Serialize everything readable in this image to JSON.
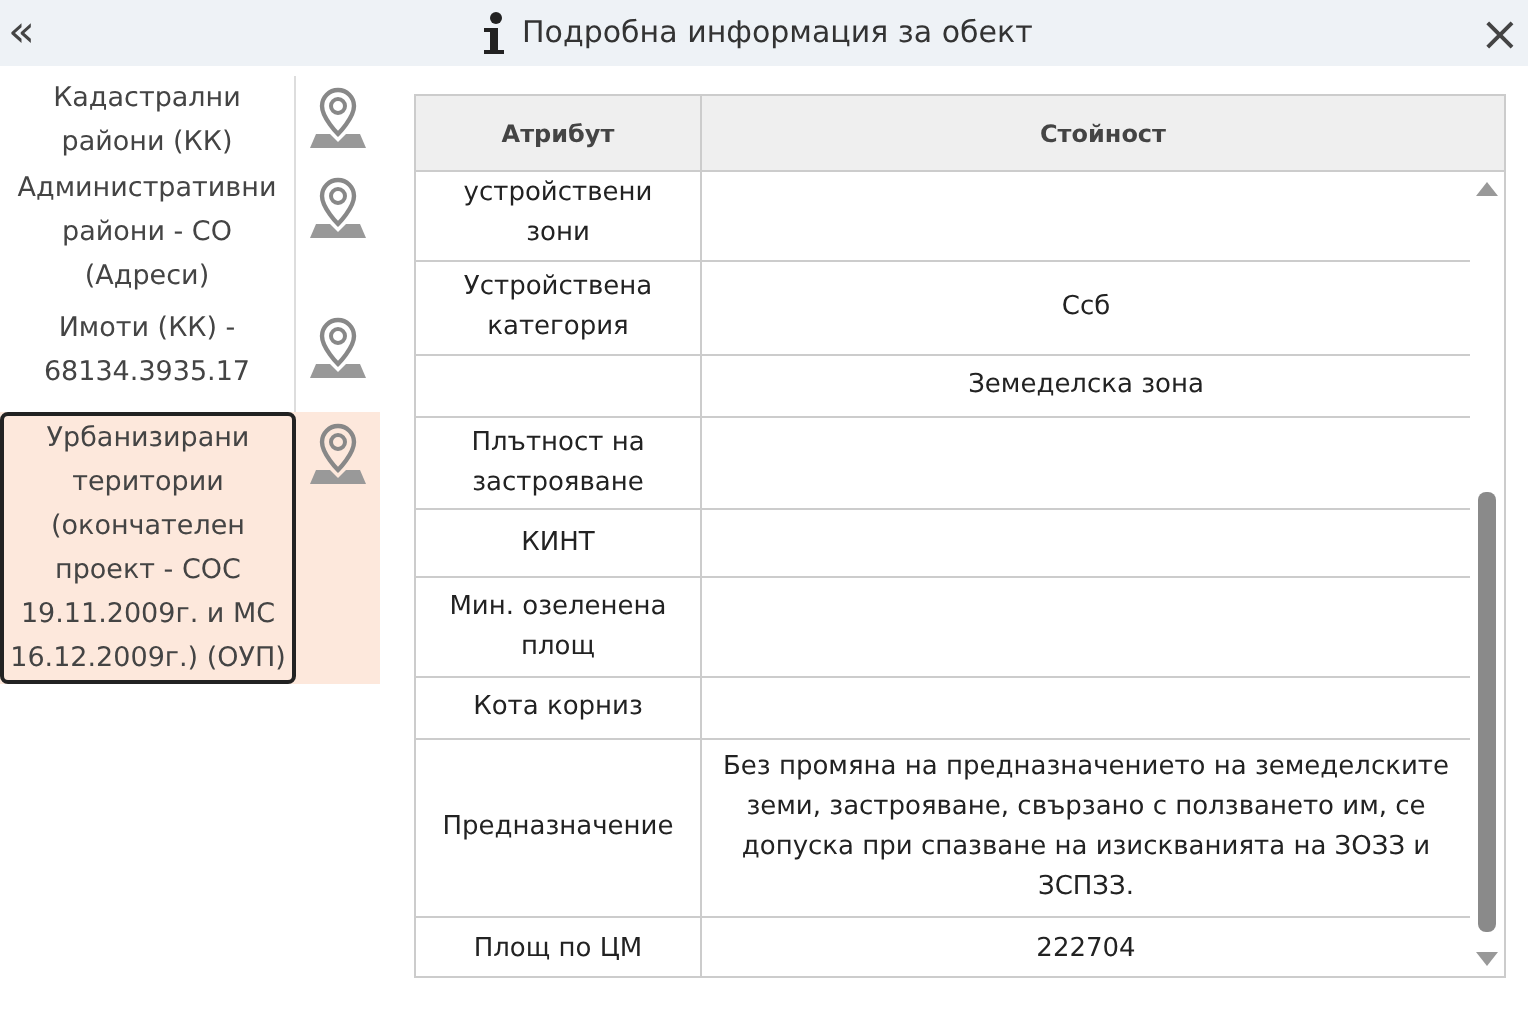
{
  "header": {
    "collapse_icon": "«",
    "title": "Подробна информация за обект",
    "close_icon": "×"
  },
  "layers": [
    {
      "label": "Кадастрални райони (КК)",
      "selected": false
    },
    {
      "label": "Административни райони - СО (Адреси)",
      "selected": false
    },
    {
      "label": "Имоти (КК) - 68134.3935.17",
      "selected": false
    },
    {
      "label": "Урбанизирани територии (окончателен проект - СОС 19.11.2009г. и МС 16.12.2009г.) (ОУП)",
      "selected": true
    }
  ],
  "table": {
    "columns": [
      "Атрибут",
      "Стойност"
    ],
    "rows": [
      {
        "attribute": "устройствени зони",
        "value": ""
      },
      {
        "attribute": "Устройствена категория",
        "value": "Ссб"
      },
      {
        "attribute": "",
        "value": "Земеделска зона"
      },
      {
        "attribute": "Плътност на застрояване",
        "value": ""
      },
      {
        "attribute": "КИНТ",
        "value": ""
      },
      {
        "attribute": "Мин. озеленена площ",
        "value": ""
      },
      {
        "attribute": "Кота корниз",
        "value": ""
      },
      {
        "attribute": "Предназначение",
        "value": "Без промяна на предназначението на земеделските земи, застрояване, свързано с ползването им, се допуска при спазване на изискванията на ЗОЗЗ и ЗСПЗЗ."
      },
      {
        "attribute": "Площ по ЦМ",
        "value": "222704"
      }
    ]
  }
}
